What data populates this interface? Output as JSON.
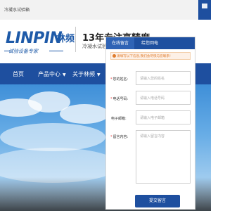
{
  "topbar": {
    "site_name": "冷凝水试验箱"
  },
  "float_bar": {
    "label": "聚焦客服",
    "icon": "square-icon"
  },
  "header": {
    "logo_text": "LINPIN",
    "logo_cn": "林频",
    "slogan": "试验设备专家",
    "tagline": "13年专注高精度",
    "sub_tagline": "冷凝水试验箱"
  },
  "nav": {
    "items": [
      {
        "label": "首页",
        "has_menu": false
      },
      {
        "label": "产品中心",
        "has_menu": true
      },
      {
        "label": "关于林频",
        "has_menu": true
      }
    ]
  },
  "panel": {
    "tabs": [
      {
        "label": "在线留言",
        "active": true
      },
      {
        "label": "给您回电",
        "active": false
      }
    ],
    "notice": "请填写以下信息,我们会尽快与您联系!",
    "fields": [
      {
        "label": "您的姓名:",
        "required": true,
        "placeholder": "请输入您的姓名"
      },
      {
        "label": "电话号码:",
        "required": true,
        "placeholder": "请输入电话号码"
      },
      {
        "label": "电子邮箱:",
        "required": false,
        "placeholder": "请输入电子邮箱"
      },
      {
        "label": "留言内容:",
        "required": true,
        "placeholder": "请输入留言内容"
      }
    ],
    "submit_label": "提交留言"
  },
  "colors": {
    "brand_blue": "#1e4f9f",
    "notice_orange": "#e07c2c",
    "required_red": "#e23b3b"
  }
}
